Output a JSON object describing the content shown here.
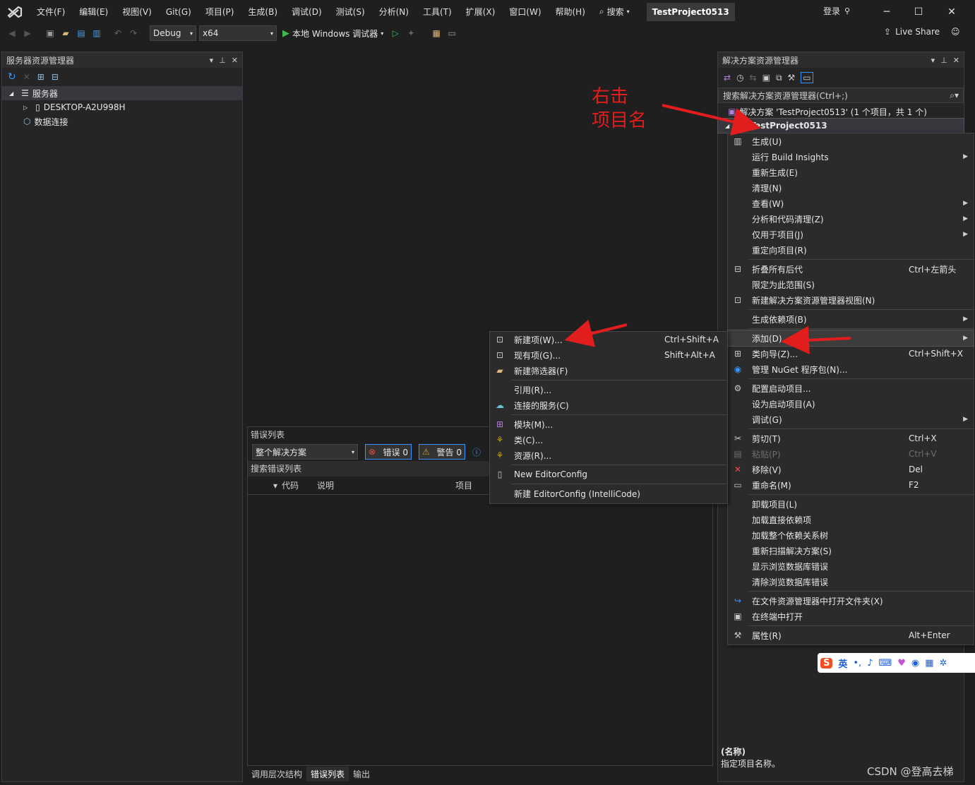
{
  "menubar": {
    "items": [
      "文件(F)",
      "编辑(E)",
      "视图(V)",
      "Git(G)",
      "项目(P)",
      "生成(B)",
      "调试(D)",
      "测试(S)",
      "分析(N)",
      "工具(T)",
      "扩展(X)",
      "窗口(W)",
      "帮助(H)"
    ],
    "search_label": "搜索",
    "project_title": "TestProject0513",
    "login": "登录"
  },
  "toolbar": {
    "config": "Debug",
    "platform": "x64",
    "run_label": "本地 Windows 调试器",
    "live_share": "Live Share"
  },
  "server_explorer": {
    "title": "服务器资源管理器",
    "servers_label": "服务器",
    "machine": "DESKTOP-A2U998H",
    "data_connections": "数据连接"
  },
  "solution_explorer": {
    "title": "解决方案资源管理器",
    "search_placeholder": "搜索解决方案资源管理器(Ctrl+;)",
    "solution_label": "解决方案 'TestProject0513' (1 个项目，共 1 个)",
    "project_label": "TestProject0513",
    "props_name_label": "(名称)",
    "props_desc": "指定项目名称。"
  },
  "error_list": {
    "title": "错误列表",
    "scope": "整个解决方案",
    "errors": "错误 0",
    "warnings": "警告 0",
    "search_label": "搜索错误列表",
    "columns": [
      "代码",
      "说明",
      "项目"
    ]
  },
  "bottom_tabs": [
    "调用层次结构",
    "错误列表",
    "输出"
  ],
  "annotation": {
    "line1": "右击",
    "line2": "项目名"
  },
  "project_menu": [
    {
      "label": "生成(U)",
      "icon": "build-icon"
    },
    {
      "label": "运行 Build Insights",
      "sub": true
    },
    {
      "label": "重新生成(E)"
    },
    {
      "label": "清理(N)"
    },
    {
      "label": "查看(W)",
      "sub": true
    },
    {
      "label": "分析和代码清理(Z)",
      "sub": true
    },
    {
      "label": "仅用于项目(J)",
      "sub": true
    },
    {
      "label": "重定向项目(R)"
    },
    {
      "sep": true
    },
    {
      "label": "折叠所有后代",
      "shortcut": "Ctrl+左箭头",
      "icon": "collapse-icon"
    },
    {
      "label": "限定为此范围(S)"
    },
    {
      "label": "新建解决方案资源管理器视图(N)",
      "icon": "new-view-icon"
    },
    {
      "sep": true
    },
    {
      "label": "生成依赖项(B)",
      "sub": true
    },
    {
      "sep": true
    },
    {
      "label": "添加(D)",
      "sub": true,
      "highlight": true
    },
    {
      "label": "类向导(Z)...",
      "shortcut": "Ctrl+Shift+X",
      "icon": "class-wizard-icon"
    },
    {
      "label": "管理 NuGet 程序包(N)...",
      "icon": "nuget-icon"
    },
    {
      "sep": true
    },
    {
      "label": "配置启动项目...",
      "icon": "gear-icon"
    },
    {
      "label": "设为启动项目(A)"
    },
    {
      "label": "调试(G)",
      "sub": true
    },
    {
      "sep": true
    },
    {
      "label": "剪切(T)",
      "shortcut": "Ctrl+X",
      "icon": "scissors-icon"
    },
    {
      "label": "粘贴(P)",
      "shortcut": "Ctrl+V",
      "icon": "paste-icon",
      "disabled": true
    },
    {
      "label": "移除(V)",
      "shortcut": "Del",
      "icon": "remove-icon"
    },
    {
      "label": "重命名(M)",
      "shortcut": "F2",
      "icon": "rename-icon"
    },
    {
      "sep": true
    },
    {
      "label": "卸载项目(L)"
    },
    {
      "label": "加载直接依赖项"
    },
    {
      "label": "加载整个依赖关系树"
    },
    {
      "label": "重新扫描解决方案(S)"
    },
    {
      "label": "显示浏览数据库错误"
    },
    {
      "label": "清除浏览数据库错误"
    },
    {
      "sep": true
    },
    {
      "label": "在文件资源管理器中打开文件夹(X)",
      "icon": "open-folder-icon"
    },
    {
      "label": "在终端中打开",
      "icon": "terminal-icon"
    },
    {
      "sep": true
    },
    {
      "label": "属性(R)",
      "shortcut": "Alt+Enter",
      "icon": "wrench-icon"
    }
  ],
  "add_menu": [
    {
      "label": "新建项(W)...",
      "shortcut": "Ctrl+Shift+A",
      "icon": "new-item-icon"
    },
    {
      "label": "现有项(G)...",
      "shortcut": "Shift+Alt+A",
      "icon": "existing-item-icon"
    },
    {
      "label": "新建筛选器(F)",
      "icon": "filter-folder-icon"
    },
    {
      "sep": true
    },
    {
      "label": "引用(R)..."
    },
    {
      "label": "连接的服务(C)",
      "icon": "connected-service-icon"
    },
    {
      "sep": true
    },
    {
      "label": "模块(M)...",
      "icon": "module-icon"
    },
    {
      "label": "类(C)...",
      "icon": "class-icon"
    },
    {
      "label": "资源(R)...",
      "icon": "resource-icon"
    },
    {
      "sep": true
    },
    {
      "label": "New EditorConfig",
      "icon": "file-icon"
    },
    {
      "sep": true
    },
    {
      "label": "新建 EditorConfig (IntelliCode)"
    }
  ],
  "ime": {
    "lang": "英"
  },
  "watermark": "CSDN @登高去梯",
  "colors": {
    "accent": "#3794ff",
    "annotation": "#e21d1d",
    "run": "#3fb950"
  }
}
